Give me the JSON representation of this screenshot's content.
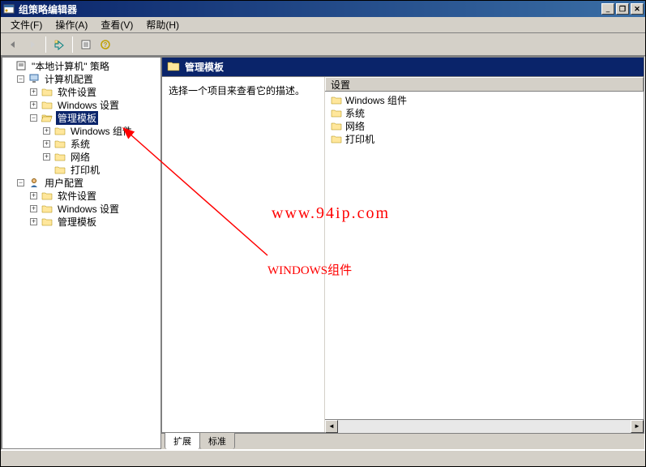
{
  "window": {
    "title": "组策略编辑器"
  },
  "menu": {
    "file": "文件(F)",
    "action": "操作(A)",
    "view": "查看(V)",
    "help": "帮助(H)"
  },
  "tree": {
    "root": "\"本地计算机\" 策略",
    "computer_config": "计算机配置",
    "software_settings": "软件设置",
    "windows_settings": "Windows 设置",
    "admin_templates": "管理模板",
    "windows_components": "Windows 组件",
    "system": "系统",
    "network": "网络",
    "printers": "打印机",
    "user_config": "用户配置"
  },
  "right": {
    "header": "管理模板",
    "description": "选择一个项目来查看它的描述。",
    "col_header": "设置",
    "items": {
      "0": "Windows 组件",
      "1": "系统",
      "2": "网络",
      "3": "打印机"
    }
  },
  "tabs": {
    "extended": "扩展",
    "standard": "标准"
  },
  "overlay": {
    "url": "www.94ip.com",
    "label": "WINDOWS组件"
  }
}
